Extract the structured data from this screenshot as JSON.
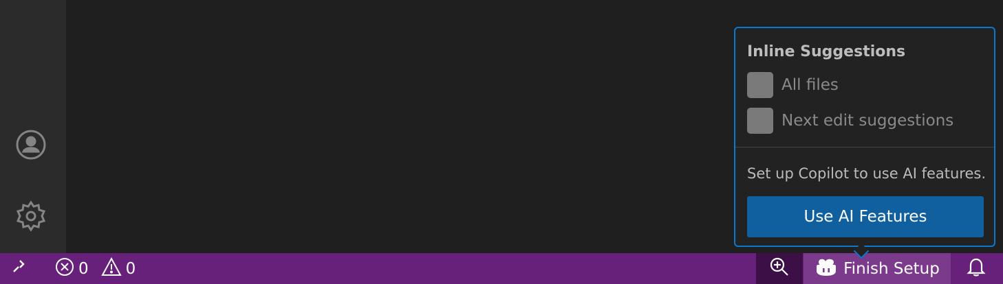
{
  "activity_bar": {
    "icons": [
      "account-icon",
      "gear-icon"
    ]
  },
  "status_bar": {
    "remote_icon": "remote-icon",
    "errors_count": "0",
    "warnings_count": "0",
    "zoom_icon": "zoom-in-icon",
    "copilot_icon": "copilot-icon",
    "copilot_label": "Finish Setup",
    "bell_icon": "bell-icon"
  },
  "popup": {
    "title": "Inline Suggestions",
    "checkboxes": [
      {
        "label": "All files",
        "checked": false
      },
      {
        "label": "Next edit suggestions",
        "checked": false
      }
    ],
    "message": "Set up Copilot to use AI features.",
    "button_label": "Use AI Features"
  },
  "colors": {
    "status_bar_bg": "#68217a",
    "popup_border": "#0e78cf",
    "button_bg": "#1060a0"
  }
}
